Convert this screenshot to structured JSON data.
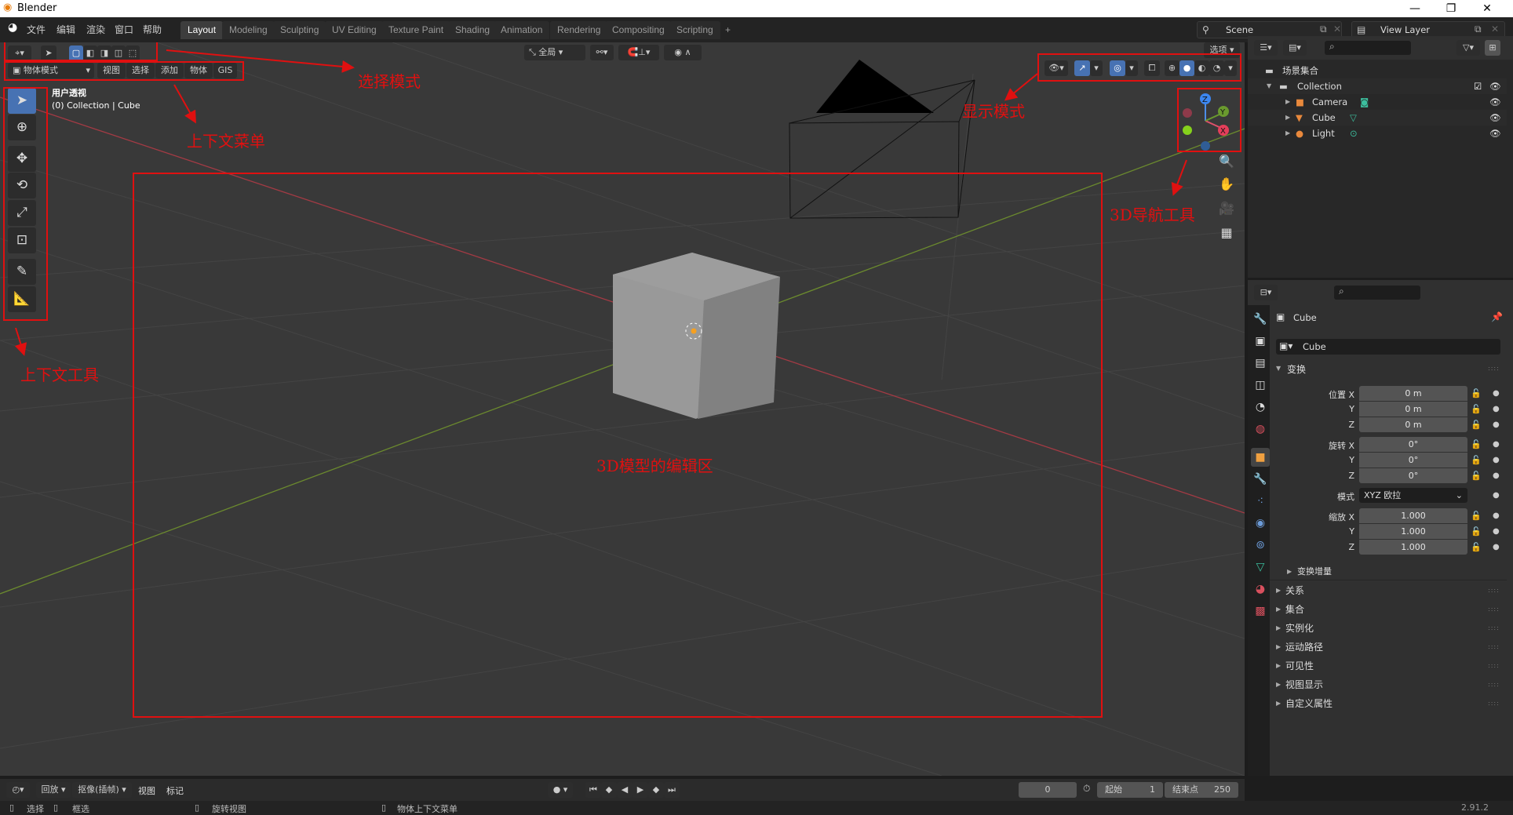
{
  "window": {
    "title": "Blender",
    "minimize": "—",
    "maximize": "❐",
    "close": "✕"
  },
  "menus": [
    "文件",
    "编辑",
    "渲染",
    "窗口",
    "帮助"
  ],
  "workspace_tabs": [
    {
      "label": "Layout",
      "active": true
    },
    {
      "label": "Modeling"
    },
    {
      "label": "Sculpting"
    },
    {
      "label": "UV Editing"
    },
    {
      "label": "Texture Paint"
    },
    {
      "label": "Shading"
    },
    {
      "label": "Animation"
    },
    {
      "label": "Rendering"
    },
    {
      "label": "Compositing"
    },
    {
      "label": "Scripting"
    },
    {
      "label": "+"
    }
  ],
  "scene": {
    "label": "Scene",
    "view_layer": "View Layer"
  },
  "viewport_header": {
    "mode": "物体模式",
    "menus": [
      "视图",
      "选择",
      "添加",
      "物体",
      "GIS"
    ],
    "transform_orientation": "全局",
    "options": "选项"
  },
  "viewport": {
    "view_name": "用户透视",
    "collection_info": "(0) Collection | Cube",
    "gizmo_axes": [
      "Z",
      "Y",
      "X"
    ]
  },
  "annotations": {
    "select_mode": "选择模式",
    "context_menu": "上下文菜单",
    "context_tools": "上下文工具",
    "display_mode": "显示模式",
    "nav_tools": "3D导航工具",
    "edit_area": "3D模型的编辑区"
  },
  "outliner": {
    "root": "场景集合",
    "collection": "Collection",
    "items": [
      {
        "name": "Camera",
        "icon": "camera-icon",
        "data_icon": "camera-data-icon"
      },
      {
        "name": "Cube",
        "icon": "mesh-icon",
        "data_icon": "mesh-data-icon"
      },
      {
        "name": "Light",
        "icon": "light-icon",
        "data_icon": "light-data-icon"
      }
    ]
  },
  "properties": {
    "object_name": "Cube",
    "object_field": "Cube",
    "transform_label": "变换",
    "location_label": "位置 X",
    "rotation_label": "旋转 X",
    "scale_label": "缩放 X",
    "y": "Y",
    "z": "Z",
    "location": [
      "0 m",
      "0 m",
      "0 m"
    ],
    "rotation": [
      "0°",
      "0°",
      "0°"
    ],
    "mode_label": "模式",
    "rotation_mode": "XYZ 欧拉",
    "scale": [
      "1.000",
      "1.000",
      "1.000"
    ],
    "delta_transform": "变换增量",
    "sections": [
      "关系",
      "集合",
      "实例化",
      "运动路径",
      "可见性",
      "视图显示",
      "自定义属性"
    ]
  },
  "timeline": {
    "playback": "回放",
    "keying": "抠像(插帧)",
    "view": "视图",
    "marker": "标记",
    "current_frame": "0",
    "start_label": "起始",
    "start": "1",
    "end_label": "结束点",
    "end": "250"
  },
  "statusbar": {
    "select": "选择",
    "box_select": "框选",
    "rotate_view": "旋转视图",
    "context_menu": "物体上下文菜单",
    "version": "2.91.2"
  }
}
